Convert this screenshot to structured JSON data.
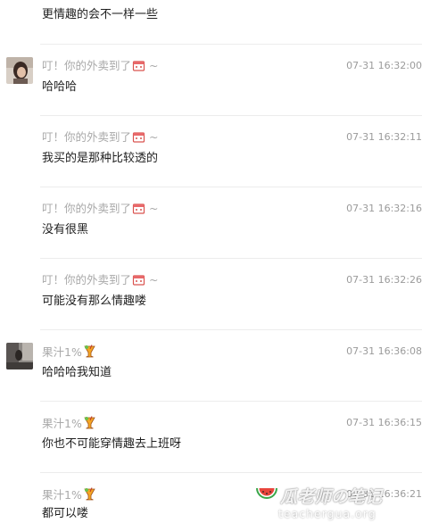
{
  "messages": [
    {
      "sender": "",
      "time": "",
      "text": "更情趣的会不一样一些",
      "avatar": "none"
    },
    {
      "sender": "叮！你的外卖到了",
      "emoji": "takeout-box-icon",
      "suffix": "~",
      "time": "07-31 16:32:00",
      "text": "哈哈哈",
      "avatar": "photo-girl"
    },
    {
      "sender": "叮！你的外卖到了",
      "emoji": "takeout-box-icon",
      "suffix": "~",
      "time": "07-31 16:32:11",
      "text": "我买的是那种比较透的",
      "avatar": "none"
    },
    {
      "sender": "叮！你的外卖到了",
      "emoji": "takeout-box-icon",
      "suffix": "~",
      "time": "07-31 16:32:16",
      "text": "没有很黑",
      "avatar": "none"
    },
    {
      "sender": "叮！你的外卖到了",
      "emoji": "takeout-box-icon",
      "suffix": "~",
      "time": "07-31 16:32:26",
      "text": "可能没有那么情趣喽",
      "avatar": "none"
    },
    {
      "sender": "果汁1%",
      "emoji": "juice-glass-icon",
      "suffix": "",
      "time": "07-31 16:36:08",
      "text": "哈哈哈我知道",
      "avatar": "photo-street"
    },
    {
      "sender": "果汁1%",
      "emoji": "juice-glass-icon",
      "suffix": "",
      "time": "07-31 16:36:15",
      "text": "你也不可能穿情趣去上班呀",
      "avatar": "none"
    },
    {
      "sender": "果汁1%",
      "emoji": "juice-glass-icon",
      "suffix": "",
      "time": "07-31 16:36:21",
      "text": "都可以喽",
      "avatar": "none"
    }
  ],
  "watermark": {
    "title": "瓜老师の笔记",
    "url": "teachergua.org"
  }
}
